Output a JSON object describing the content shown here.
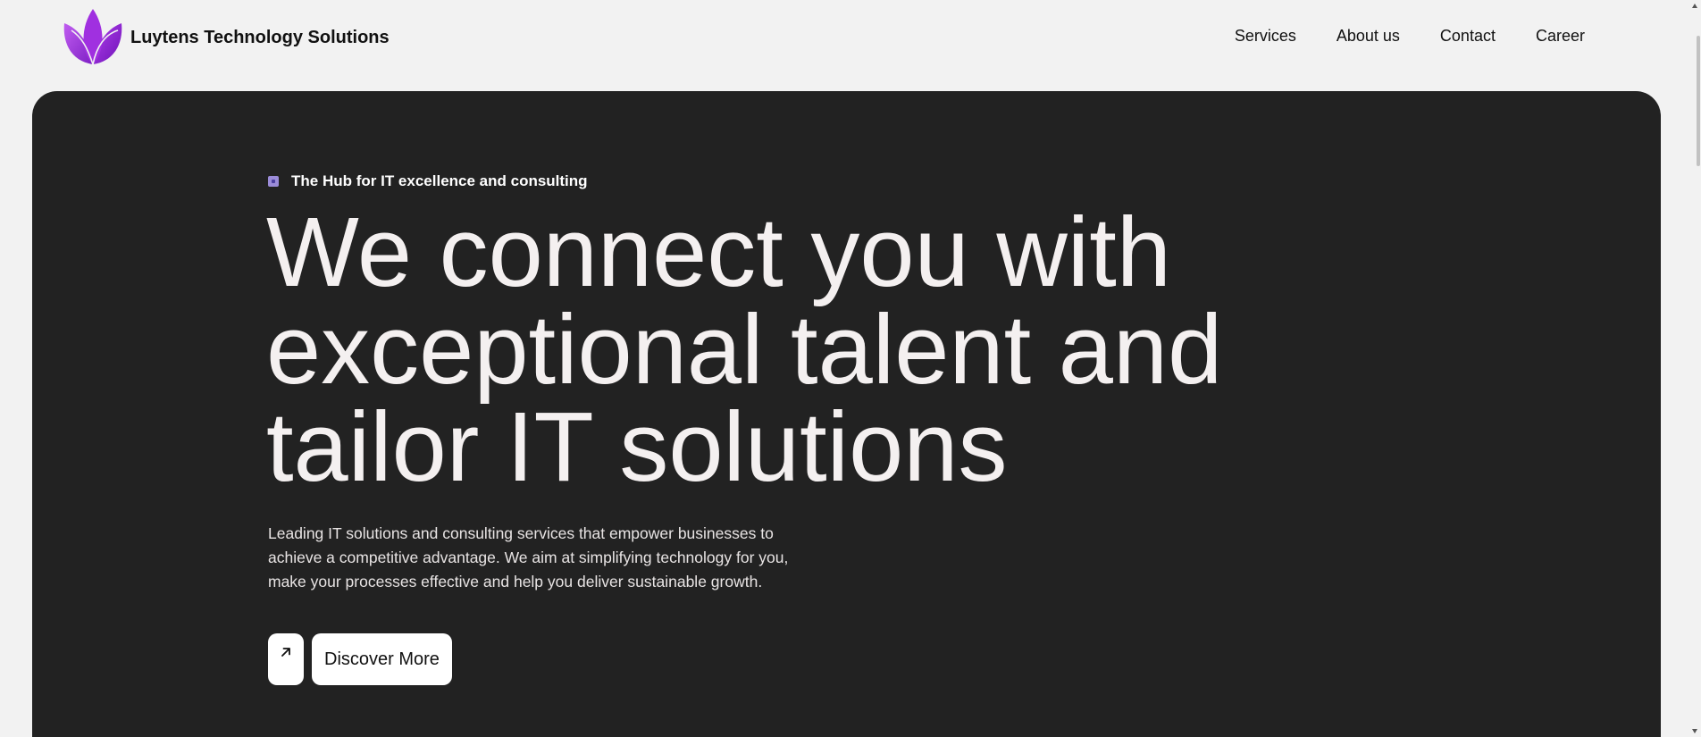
{
  "header": {
    "brand_name": "Luytens Technology Solutions",
    "logo_icon": "lotus-logo-icon",
    "nav": [
      {
        "label": "Services"
      },
      {
        "label": "About us"
      },
      {
        "label": "Contact"
      },
      {
        "label": "Career"
      }
    ]
  },
  "hero": {
    "tagline": "The Hub for IT excellence and consulting",
    "headline_lines": [
      "We connect you with",
      "exceptional talent and",
      "tailor IT solutions"
    ],
    "description": "Leading IT solutions and consulting services that empower businesses to achieve a competitive advantage. We aim at simplifying technology for you, make your processes effective and help you deliver sustainable growth.",
    "cta_icon": "arrow-up-right-icon",
    "cta_label": "Discover More"
  },
  "colors": {
    "page_background": "#f2f2f2",
    "hero_background": "#222222",
    "brand_purple": "#9b30d9",
    "headline_text": "#f4f0f0"
  }
}
